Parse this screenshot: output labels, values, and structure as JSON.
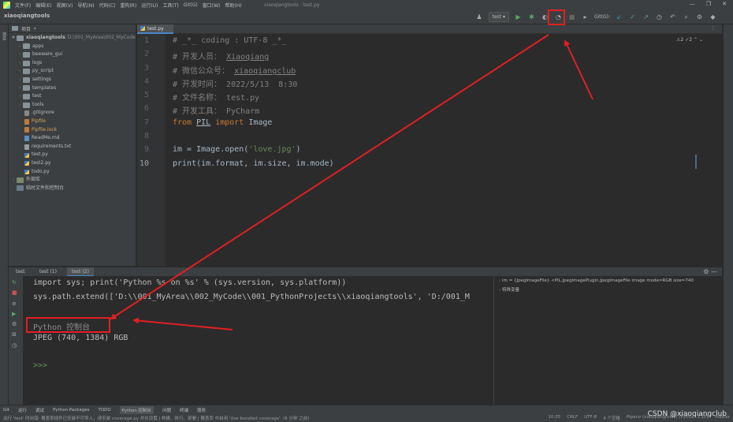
{
  "menubar": {
    "items": [
      "文件(F)",
      "编辑(E)",
      "视图(V)",
      "导航(N)",
      "代码(C)",
      "重构(R)",
      "运行(U)",
      "工具(T)",
      "Git(G)",
      "窗口(W)",
      "帮助(H)"
    ],
    "title": "xiaoqiangtools - test.py",
    "window_controls": [
      "—",
      "❐",
      "✕"
    ]
  },
  "navbar": {
    "breadcrumb": "xiaoqiangtools",
    "run_config": "test",
    "git_label": "Git(G):"
  },
  "project": {
    "header": "项目",
    "root_name": "xiaoqiangtools",
    "root_path": "D:\\001_MyArea\\002_MyCode",
    "folders": [
      "apps",
      "beeware_gui",
      "logs",
      "py_script",
      "settings",
      "templates",
      "test",
      "tools"
    ],
    "files": [
      ".gitignore",
      "Pipfile",
      "Pipfile.lock",
      "ReadMe.md",
      "requirements.txt",
      "test.py",
      "test2.py",
      "todo.py"
    ],
    "extra": [
      "外部库",
      "临时文件和控制台"
    ]
  },
  "editor": {
    "tab": "test.py",
    "inspections": "⚠2  ✓2  ⌃  ⌄",
    "line_numbers": [
      "1",
      "2",
      "3",
      "4",
      "5",
      "6",
      "7",
      "8",
      "9",
      "10"
    ],
    "lines": {
      "l1": "# _*_ coding : UTF-8 _*_",
      "l2a": "# 开发人员： ",
      "l2b": "Xiaoqiang",
      "l3a": "# 微信公众号： ",
      "l3b": "xiaoqiangclub",
      "l4": "# 开发时间： 2022/5/13  8:30",
      "l5": "# 文件名称： test.py",
      "l6": "# 开发工具： PyCharm",
      "l7a": "from ",
      "l7b": "PIL",
      "l7c": " import ",
      "l7d": "Image",
      "l9a": "im = Image.open(",
      "l9b": "'love.jpg'",
      "l9c": ")",
      "l10": "print(im.format, im.size, im.mode)"
    }
  },
  "console": {
    "tabs": [
      "test",
      "test (1)",
      "test (2)"
    ],
    "lines": {
      "c1": "import sys; print('Python %s on %s' % (sys.version, sys.platform))",
      "c2": "sys.path.extend(['D:\\\\001_MyArea\\\\002_MyCode\\\\001_PythonProjects\\\\xiaoqiangtools', 'D:/001_M",
      "c3": "Python 控制台",
      "c4": "JPEG (740, 1384) RGB",
      "c5": ">>>"
    },
    "vars": {
      "v1": "im = {JpegImageFile} <PIL.JpegImagePlugin.JpegImageFile image mode=RGB size=740",
      "v2": "特殊变量"
    }
  },
  "toolwindows": [
    "Git",
    "运行",
    "调试",
    "Python Packages",
    "TODO",
    "Python 控制台",
    "问题",
    "终端",
    "服务"
  ],
  "status": {
    "message": "运行 'test' 时出错: 覆盖率插件已安装不可导入，请安装 coverage.py 并在设置 | 构建、执行、部署 | 覆盖率 中启用 'Use bundled coverage'. (6 分钟 之前)",
    "position": "10:35",
    "line_sep": "CRLF",
    "encoding": "UTF-8",
    "indent": "4 个空格",
    "interpreter": "Pipenv (xiaoqiangtools) (Python 3.10)",
    "branch": "master"
  },
  "watermark": "CSDN @xiaoqiangclub",
  "annotation_color": "#e02020"
}
